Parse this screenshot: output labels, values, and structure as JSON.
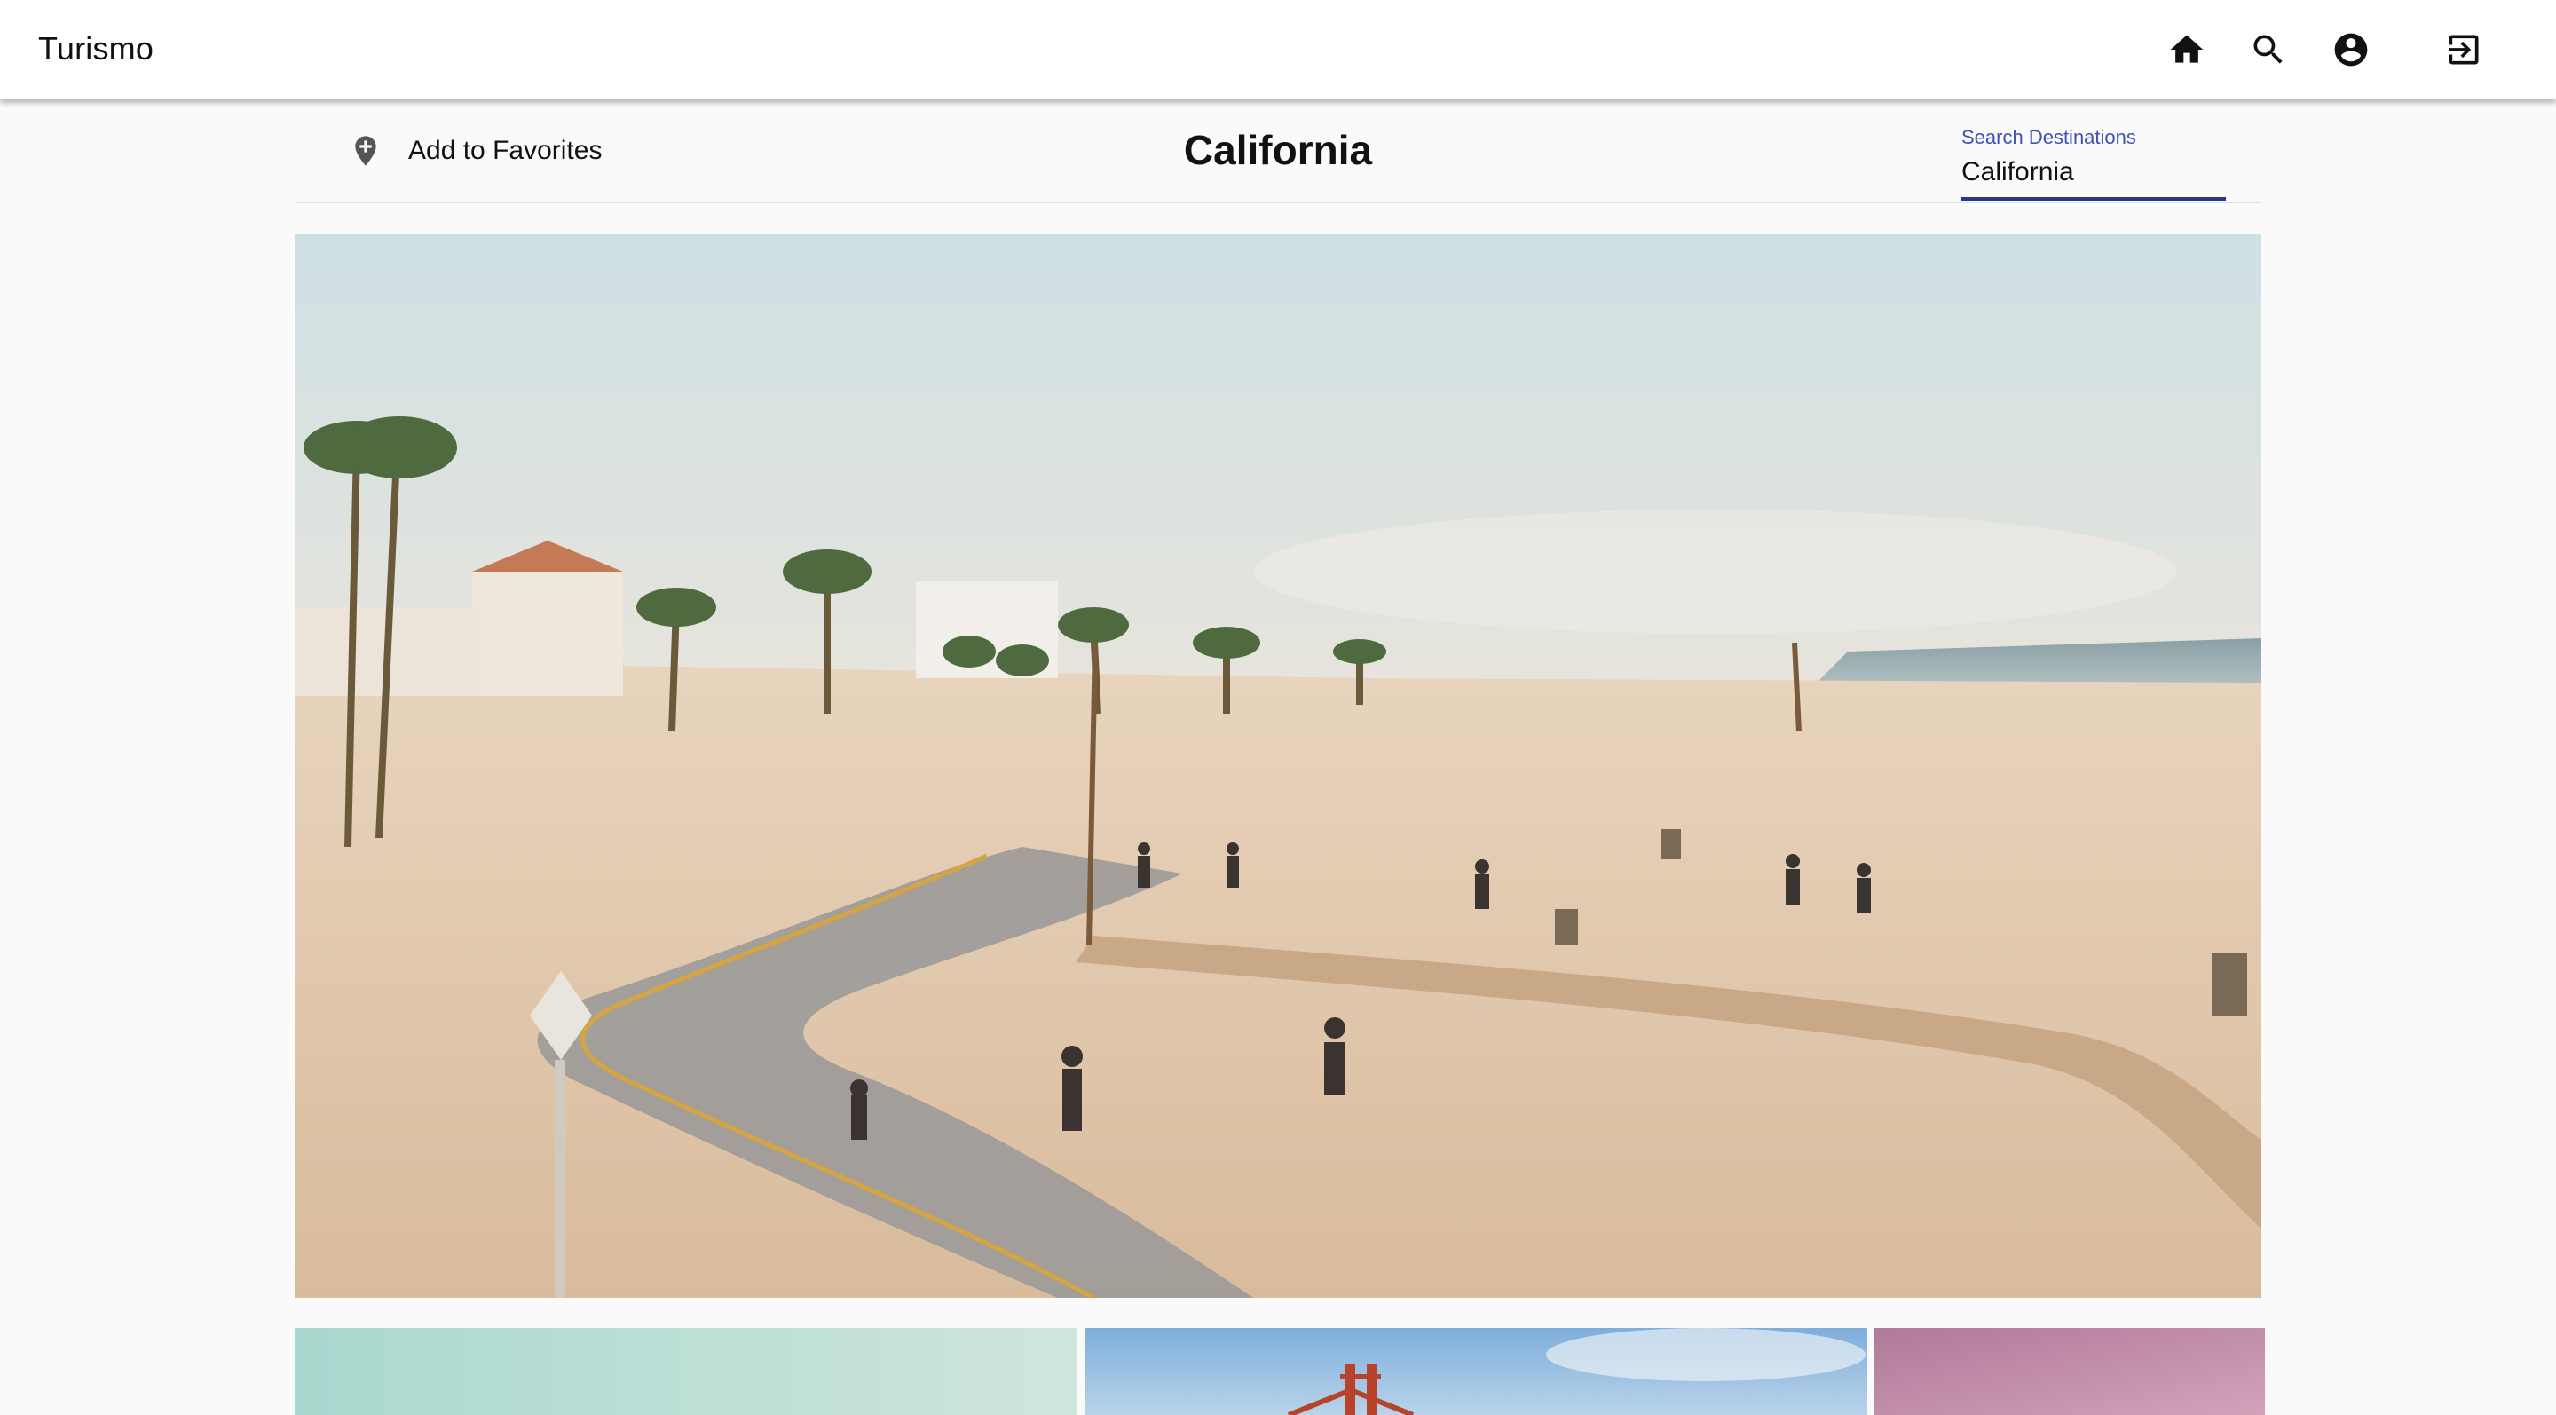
{
  "app": {
    "title": "Turismo",
    "nav": [
      {
        "name": "home",
        "icon": "home-icon"
      },
      {
        "name": "search",
        "icon": "search-icon"
      },
      {
        "name": "account",
        "icon": "account-circle-icon"
      },
      {
        "name": "logout",
        "icon": "exit-to-app-icon"
      }
    ]
  },
  "destination": {
    "title": "California",
    "favorite_label": "Add to Favorites",
    "favorite_icon": "add-location-icon"
  },
  "search": {
    "label": "Search Destinations",
    "value": "California"
  },
  "gallery": {
    "hero_alt": "Beach boardwalk with bike path and palm trees",
    "thumbnails": [
      "mint-sky",
      "golden-gate-bridge",
      "pink-sunset"
    ]
  },
  "colors": {
    "accent": "#3f51b5",
    "underline": "#283593",
    "appbar": "#ffffff"
  }
}
